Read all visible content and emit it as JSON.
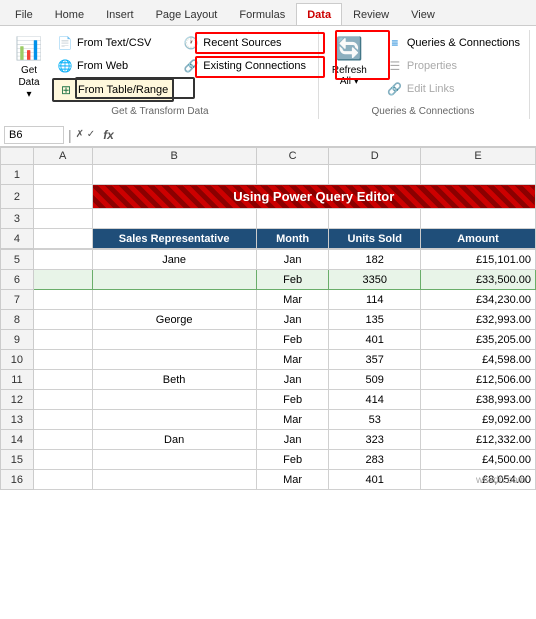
{
  "tabs": [
    "File",
    "Home",
    "Insert",
    "Page Layout",
    "Formulas",
    "Data",
    "Review",
    "View"
  ],
  "active_tab": "Data",
  "ribbon": {
    "group1": {
      "label": "Get & Transform Data",
      "btn_get_data": "Get\nData",
      "btn_from_text": "From Text/CSV",
      "btn_from_web": "From Web",
      "btn_from_table": "From Table/Range",
      "btn_recent_sources": "Recent Sources",
      "btn_existing_connections": "Existing Connections"
    },
    "group2": {
      "label": "Queries & Connections",
      "btn_refresh_all": "Refresh\nAll",
      "btn_queries_connections": "Queries & Connections",
      "btn_properties": "Properties",
      "btn_edit_links": "Edit Links"
    }
  },
  "formula_bar": {
    "name_box": "B6",
    "fx": "fx"
  },
  "col_headers": [
    "",
    "A",
    "B",
    "C",
    "D",
    "E"
  ],
  "title_row": "Using Power Query Editor",
  "table_headers": [
    "Sales Representative",
    "Month",
    "Units Sold",
    "Amount"
  ],
  "rows": [
    {
      "rep": "Jane",
      "month": "Jan",
      "units": "182",
      "amount": "£15,101.00"
    },
    {
      "rep": "",
      "month": "Feb",
      "units": "3350",
      "amount": "£33,500.00"
    },
    {
      "rep": "",
      "month": "Mar",
      "units": "114",
      "amount": "£34,230.00"
    },
    {
      "rep": "George",
      "month": "Jan",
      "units": "135",
      "amount": "£32,993.00"
    },
    {
      "rep": "",
      "month": "Feb",
      "units": "401",
      "amount": "£35,205.00"
    },
    {
      "rep": "",
      "month": "Mar",
      "units": "357",
      "amount": "£4,598.00"
    },
    {
      "rep": "Beth",
      "month": "Jan",
      "units": "509",
      "amount": "£12,506.00"
    },
    {
      "rep": "",
      "month": "Feb",
      "units": "414",
      "amount": "£38,993.00"
    },
    {
      "rep": "",
      "month": "Mar",
      "units": "53",
      "amount": "£9,092.00"
    },
    {
      "rep": "Dan",
      "month": "Jan",
      "units": "323",
      "amount": "£12,332.00"
    },
    {
      "rep": "",
      "month": "Feb",
      "units": "283",
      "amount": "£4,500.00"
    },
    {
      "rep": "",
      "month": "Mar",
      "units": "401",
      "amount": "£8,054.00"
    }
  ],
  "watermark": "wsxdn.com"
}
